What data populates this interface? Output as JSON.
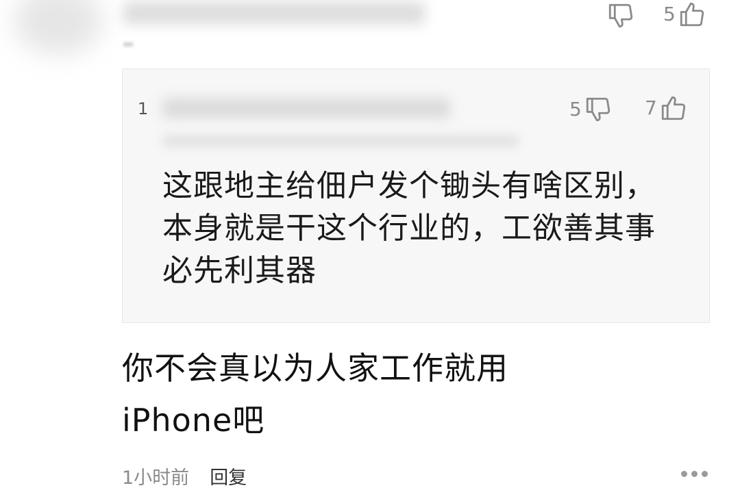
{
  "top_comment": {
    "dislike_count": "",
    "like_count": "5"
  },
  "quoted_reply": {
    "index": "1",
    "dislike_count": "5",
    "like_count": "7",
    "text": "这跟地主给佃户发个锄头有啥区别，本身就是干这个行业的，工欲善其事 必先利其器"
  },
  "reply": {
    "text": "你不会真以为人家工作就用iPhone吧",
    "time": "1小时前",
    "reply_label": "回复"
  },
  "icons": {
    "dislike": "thumbs-down-icon",
    "like": "thumbs-up-icon",
    "more": "more-dots-icon"
  },
  "colors": {
    "quote_background": "#f7f7f7",
    "muted_text": "#8a8a8a"
  }
}
